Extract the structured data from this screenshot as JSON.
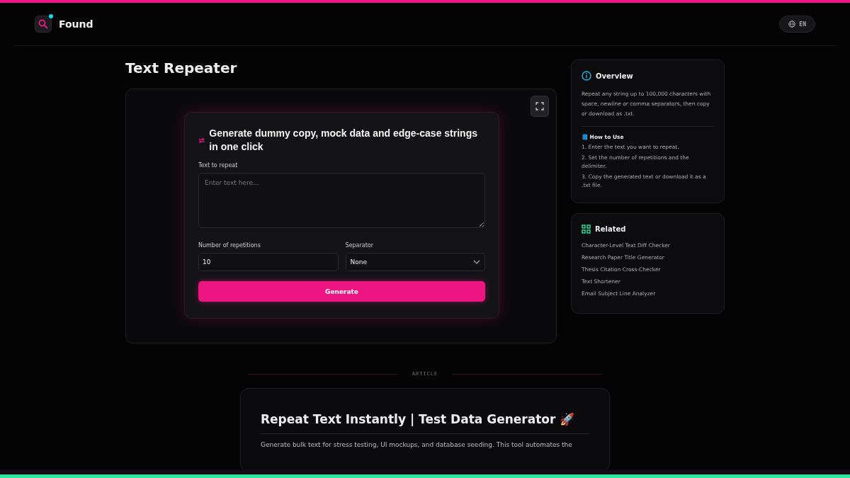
{
  "header": {
    "brand": "Found",
    "language": "EN"
  },
  "page_title": "Text Repeater",
  "tool": {
    "heading": "Generate dummy copy, mock data and edge-case strings in one click",
    "text_label": "Text to repeat",
    "text_placeholder": "Enter text here...",
    "repetitions_label": "Number of repetitions",
    "repetitions_value": "10",
    "separator_label": "Separator",
    "separator_value": "None",
    "generate_button": "Generate"
  },
  "overview": {
    "title": "Overview",
    "description": "Repeat any string up to 100,000 characters with space, newline or comma separators, then copy or download as .txt.",
    "howto_title": "📘 How to Use",
    "steps": [
      "1. Enter the text you want to repeat.",
      "2. Set the number of repetitions and the delimiter.",
      "3. Copy the generated text or download it as a .txt file."
    ]
  },
  "related": {
    "title": "Related",
    "links": [
      "Character-Level Text Diff Checker",
      "Research Paper Title Generator",
      "Thesis Citation Cross-Checker",
      "Text Shortener",
      "Email Subject Line Analyzer"
    ]
  },
  "article": {
    "label": "ARTICLE",
    "title": "Repeat Text Instantly | Test Data Generator 🚀",
    "intro": "Generate bulk text for stress testing, UI mockups, and database seeding. This tool automates the"
  }
}
